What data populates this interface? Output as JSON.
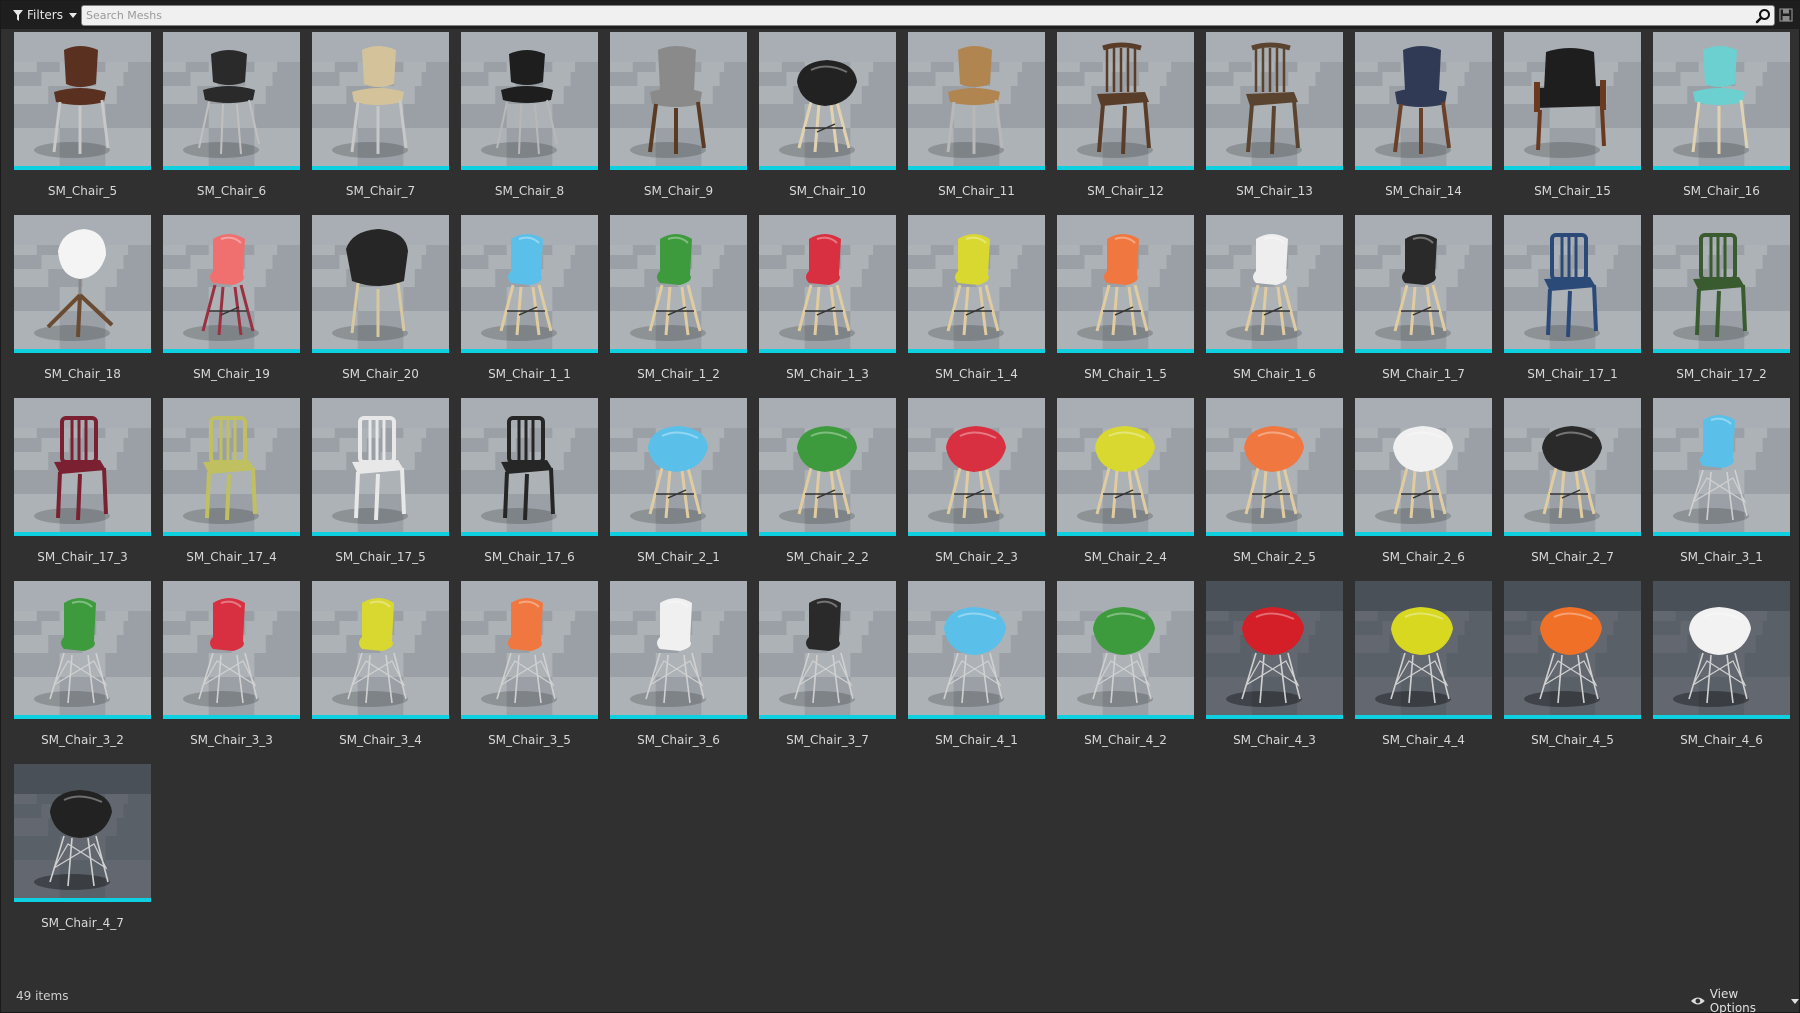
{
  "toolbar": {
    "filters_label": "Filters",
    "search_placeholder": "Search Meshs",
    "search_value": ""
  },
  "assets": [
    {
      "name": "SM_Chair_5",
      "style": "wood",
      "seat": "#5a3020",
      "legs": "#c8c8c8"
    },
    {
      "name": "SM_Chair_6",
      "style": "office",
      "seat": "#2a2a2a",
      "legs": "#c0c0c0"
    },
    {
      "name": "SM_Chair_7",
      "style": "wood",
      "seat": "#d4c29a",
      "legs": "#c8c8c8"
    },
    {
      "name": "SM_Chair_8",
      "style": "office",
      "seat": "#1e1e1e",
      "legs": "#b8b8b8"
    },
    {
      "name": "SM_Chair_9",
      "style": "padded",
      "seat": "#8a8a8a",
      "legs": "#5a3a22"
    },
    {
      "name": "SM_Chair_10",
      "style": "arm",
      "seat": "#222222",
      "legs": "#e2d2b0"
    },
    {
      "name": "SM_Chair_11",
      "style": "wood",
      "seat": "#b08550",
      "legs": "#b8b8b8"
    },
    {
      "name": "SM_Chair_12",
      "style": "spindle",
      "seat": "#5a3d28",
      "legs": "#5a3d28"
    },
    {
      "name": "SM_Chair_13",
      "style": "spindle",
      "seat": "#5a4430",
      "legs": "#5a4430"
    },
    {
      "name": "SM_Chair_14",
      "style": "padded",
      "seat": "#303a55",
      "legs": "#6a4028"
    },
    {
      "name": "SM_Chair_15",
      "style": "lounge",
      "seat": "#1e1e1e",
      "legs": "#6a3a20"
    },
    {
      "name": "SM_Chair_16",
      "style": "wood",
      "seat": "#6cd0d0",
      "legs": "#e0d2b2"
    },
    {
      "name": "SM_Chair_18",
      "style": "swivel",
      "seat": "#f4f4f4",
      "legs": "#6a4a30"
    },
    {
      "name": "SM_Chair_19",
      "style": "shell",
      "seat": "#f07070",
      "legs": "#9a3040"
    },
    {
      "name": "SM_Chair_20",
      "style": "tub",
      "seat": "#262626",
      "legs": "#d8c8a0"
    },
    {
      "name": "SM_Chair_1_1",
      "style": "shell",
      "seat": "#5ac0ea",
      "legs": "#e0cca0"
    },
    {
      "name": "SM_Chair_1_2",
      "style": "shell",
      "seat": "#3d9a3d",
      "legs": "#e0cca0"
    },
    {
      "name": "SM_Chair_1_3",
      "style": "shell",
      "seat": "#d83040",
      "legs": "#e0cca0"
    },
    {
      "name": "SM_Chair_1_4",
      "style": "shell",
      "seat": "#d8d830",
      "legs": "#e0cca0"
    },
    {
      "name": "SM_Chair_1_5",
      "style": "shell",
      "seat": "#f07840",
      "legs": "#e0cca0"
    },
    {
      "name": "SM_Chair_1_6",
      "style": "shell",
      "seat": "#eeeeee",
      "legs": "#e0cca0"
    },
    {
      "name": "SM_Chair_1_7",
      "style": "shell",
      "seat": "#2a2a2a",
      "legs": "#e0cca0"
    },
    {
      "name": "SM_Chair_17_1",
      "style": "navy",
      "seat": "#2c4a78",
      "legs": "#2c4a78"
    },
    {
      "name": "SM_Chair_17_2",
      "style": "navy",
      "seat": "#3a5a30",
      "legs": "#3a5a30"
    },
    {
      "name": "SM_Chair_17_3",
      "style": "navy",
      "seat": "#7a2030",
      "legs": "#7a2030"
    },
    {
      "name": "SM_Chair_17_4",
      "style": "navy",
      "seat": "#c0c060",
      "legs": "#c0c060"
    },
    {
      "name": "SM_Chair_17_5",
      "style": "navy",
      "seat": "#e8e8e8",
      "legs": "#e8e8e8"
    },
    {
      "name": "SM_Chair_17_6",
      "style": "navy",
      "seat": "#262626",
      "legs": "#262626"
    },
    {
      "name": "SM_Chair_2_1",
      "style": "arm",
      "seat": "#5ac0ea",
      "legs": "#e0cca0"
    },
    {
      "name": "SM_Chair_2_2",
      "style": "arm",
      "seat": "#3d9a3d",
      "legs": "#e0cca0"
    },
    {
      "name": "SM_Chair_2_3",
      "style": "arm",
      "seat": "#d83040",
      "legs": "#e0cca0"
    },
    {
      "name": "SM_Chair_2_4",
      "style": "arm",
      "seat": "#d8d830",
      "legs": "#e0cca0"
    },
    {
      "name": "SM_Chair_2_5",
      "style": "arm",
      "seat": "#f07840",
      "legs": "#e0cca0"
    },
    {
      "name": "SM_Chair_2_6",
      "style": "arm",
      "seat": "#f0f0f0",
      "legs": "#e0cca0"
    },
    {
      "name": "SM_Chair_2_7",
      "style": "arm",
      "seat": "#2a2a2a",
      "legs": "#e0cca0"
    },
    {
      "name": "SM_Chair_3_1",
      "style": "wire",
      "seat": "#5ac0ea",
      "legs": "#d0d0d0"
    },
    {
      "name": "SM_Chair_3_2",
      "style": "wire",
      "seat": "#3d9a3d",
      "legs": "#d0d0d0"
    },
    {
      "name": "SM_Chair_3_3",
      "style": "wire",
      "seat": "#d83040",
      "legs": "#d0d0d0"
    },
    {
      "name": "SM_Chair_3_4",
      "style": "wire",
      "seat": "#d8d830",
      "legs": "#d0d0d0"
    },
    {
      "name": "SM_Chair_3_5",
      "style": "wire",
      "seat": "#f07840",
      "legs": "#d0d0d0"
    },
    {
      "name": "SM_Chair_3_6",
      "style": "wire",
      "seat": "#f0f0f0",
      "legs": "#d0d0d0"
    },
    {
      "name": "SM_Chair_3_7",
      "style": "wire",
      "seat": "#2a2a2a",
      "legs": "#d0d0d0"
    },
    {
      "name": "SM_Chair_4_1",
      "style": "armwire",
      "seat": "#5ac0ea",
      "legs": "#d0d0d0"
    },
    {
      "name": "SM_Chair_4_2",
      "style": "armwire",
      "seat": "#3d9a3d",
      "legs": "#d0d0d0"
    },
    {
      "name": "SM_Chair_4_3",
      "style": "armwire",
      "seat": "#d41e28",
      "legs": "#d0d0d0",
      "dark": true
    },
    {
      "name": "SM_Chair_4_4",
      "style": "armwire",
      "seat": "#d8d820",
      "legs": "#d0d0d0",
      "dark": true
    },
    {
      "name": "SM_Chair_4_5",
      "style": "armwire",
      "seat": "#f07028",
      "legs": "#d0d0d0",
      "dark": true
    },
    {
      "name": "SM_Chair_4_6",
      "style": "armwire",
      "seat": "#f2f2f2",
      "legs": "#d0d0d0",
      "dark": true
    },
    {
      "name": "SM_Chair_4_7",
      "style": "armwire",
      "seat": "#222222",
      "legs": "#d0d0d0",
      "dark": true
    }
  ],
  "footer": {
    "item_count": "49 items",
    "view_options_label": "View Options"
  },
  "colors": {
    "selection_bar": "#0fd0e0",
    "background": "#303030",
    "toolbar": "#1e1e1e"
  }
}
